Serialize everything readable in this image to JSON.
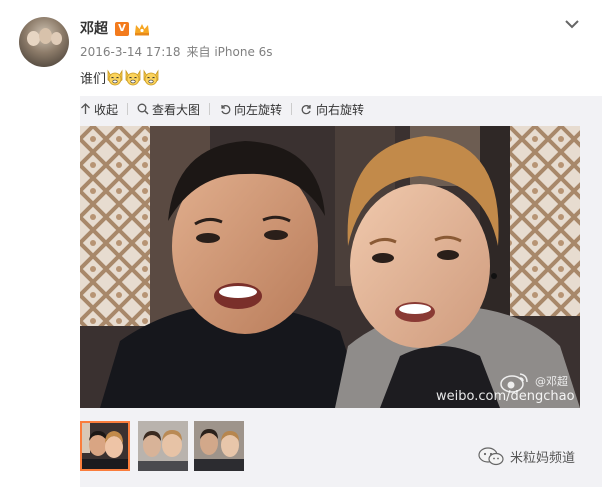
{
  "post": {
    "user_name": "邓超",
    "verified_badge": "V",
    "time": "2016-3-14 17:18",
    "source": "来自 iPhone 6s",
    "text": "谁们",
    "emoji_count": 3
  },
  "toolbar": {
    "collapse_label": "收起",
    "view_large_label": "查看大图",
    "rotate_left_label": "向左旋转",
    "rotate_right_label": "向右旋转"
  },
  "photo": {
    "watermark_handle": "@邓超",
    "watermark_url": "weibo.com/dengchao"
  },
  "thumbnails": {
    "count": 3,
    "selected_index": 0
  },
  "overlay": {
    "channel_name": "米粒妈频道"
  },
  "colors": {
    "accent": "#fa7d3c",
    "verified": "#f37b1d",
    "media_bg": "#f2f2f5"
  }
}
